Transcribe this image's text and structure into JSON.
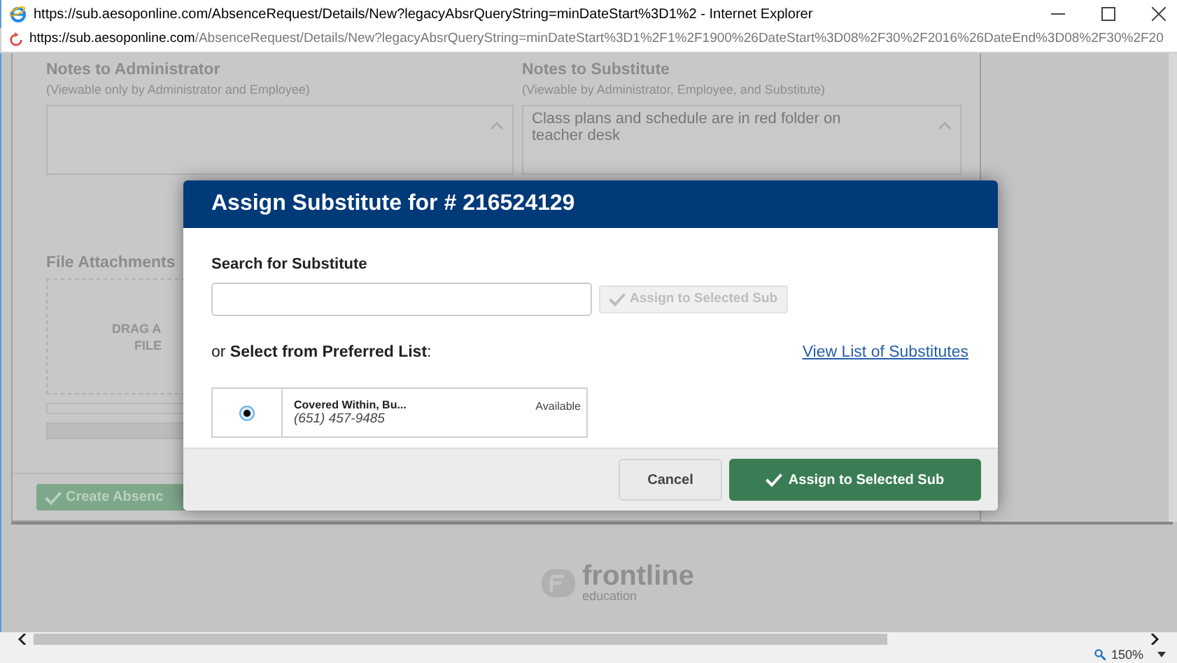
{
  "window": {
    "title": "https://sub.aesoponline.com/AbsenceRequest/Details/New?legacyAbsrQueryString=minDateStart%3D1%2 - Internet Explorer"
  },
  "address_bar": {
    "url_prefix": "https://sub.",
    "url_domain": "aesoponline.com",
    "url_path": "/AbsenceRequest/Details/New?legacyAbsrQueryString=minDateStart%3D1%2F1%2F1900%26DateStart%3D08%2F30%2F2016%26DateEnd%3D08%2F30%2F20"
  },
  "page": {
    "notes_admin": {
      "label": "Notes to Administrator",
      "hint": "(Viewable only by Administrator and Employee)"
    },
    "notes_sub": {
      "label": "Notes to Substitute",
      "hint": "(Viewable by Administrator, Employee, and Substitute)",
      "value": "Class plans and schedule are in red folder on teacher desk"
    },
    "attachments": {
      "label": "File Attachments",
      "drop_hint": [
        "DRAG A",
        "FILE"
      ]
    },
    "create_button": "Create Absenc"
  },
  "modal": {
    "title": "Assign Substitute for # 216524129",
    "search_label": "Search for Substitute",
    "search_button": {
      "label": "Assign to Selected Sub",
      "disabled": true
    },
    "list_label": "or **Select from Preferred List**:",
    "link": "View List of Substitutes",
    "substitutes": [
      {
        "name": "Covered Within, Bu...",
        "phone": "(651) 457-9485",
        "status": "Available",
        "selected": true
      }
    ],
    "cancel": "Cancel",
    "assign": "Assign to Selected Sub"
  },
  "footer_logo": {
    "name": "frontline",
    "tagline": "education"
  },
  "status_bar": {
    "zoom": "150%"
  }
}
